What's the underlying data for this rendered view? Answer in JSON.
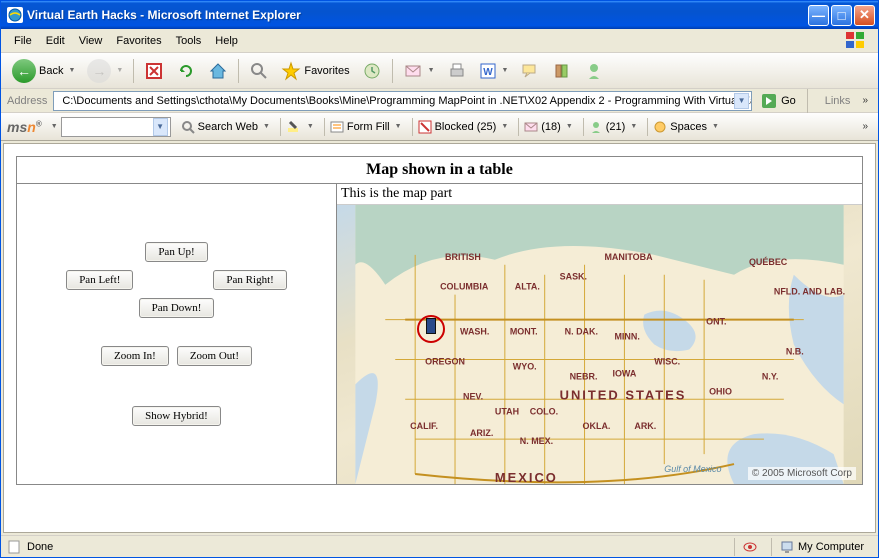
{
  "window": {
    "title": "Virtual Earth Hacks - Microsoft Internet Explorer"
  },
  "menu": {
    "file": "File",
    "edit": "Edit",
    "view": "View",
    "favorites": "Favorites",
    "tools": "Tools",
    "help": "Help"
  },
  "toolbar": {
    "back": "Back",
    "favorites": "Favorites"
  },
  "address": {
    "label": "Address",
    "value": "C:\\Documents and Settings\\cthota\\My Documents\\Books\\Mine\\Programming MapPoint in .NET\\X02 Appendix 2 - Programming With Virtual Ea",
    "go": "Go",
    "links": "Links"
  },
  "msn": {
    "search": "Search Web",
    "formfill": "Form Fill",
    "blocked_label": "Blocked (25)",
    "mail_count": "(18)",
    "buddy_count": "(21)",
    "spaces": "Spaces"
  },
  "demo": {
    "title": "Map shown in a table",
    "maplabel": "This is the map part",
    "panup": "Pan Up!",
    "pandown": "Pan Down!",
    "panleft": "Pan Left!",
    "panright": "Pan Right!",
    "zoomin": "Zoom In!",
    "zoomout": "Zoom Out!",
    "hybrid": "Show Hybrid!",
    "copyright": "© 2005 Microsoft Corp"
  },
  "map_labels": {
    "us": "UNITED STATES",
    "mexico": "MEXICO",
    "bc1": "BRITISH",
    "bc2": "COLUMBIA",
    "alta": "ALTA.",
    "sask": "SASK.",
    "manitoba": "MANITOBA",
    "ont": "ONT.",
    "quebec": "QUÉBEC",
    "nfld": "NFLD. AND LAB.",
    "nb": "N.B.",
    "wash": "WASH.",
    "oregon": "OREGON",
    "calif": "CALIF.",
    "nev": "NEV.",
    "ariz": "ARIZ.",
    "utah": "UTAH",
    "mont": "MONT.",
    "wyo": "WYO.",
    "colo": "COLO.",
    "nmex": "N. MEX.",
    "ndak": "N. DAK.",
    "nebr": "NEBR.",
    "okla": "OKLA.",
    "minn": "MINN.",
    "iowa": "IOWA",
    "ark": "ARK.",
    "wisc": "WISC.",
    "ohio": "OHIO",
    "ny": "N.Y.",
    "gulf": "Gulf of Mexico"
  },
  "status": {
    "done": "Done",
    "zone": "My Computer"
  }
}
